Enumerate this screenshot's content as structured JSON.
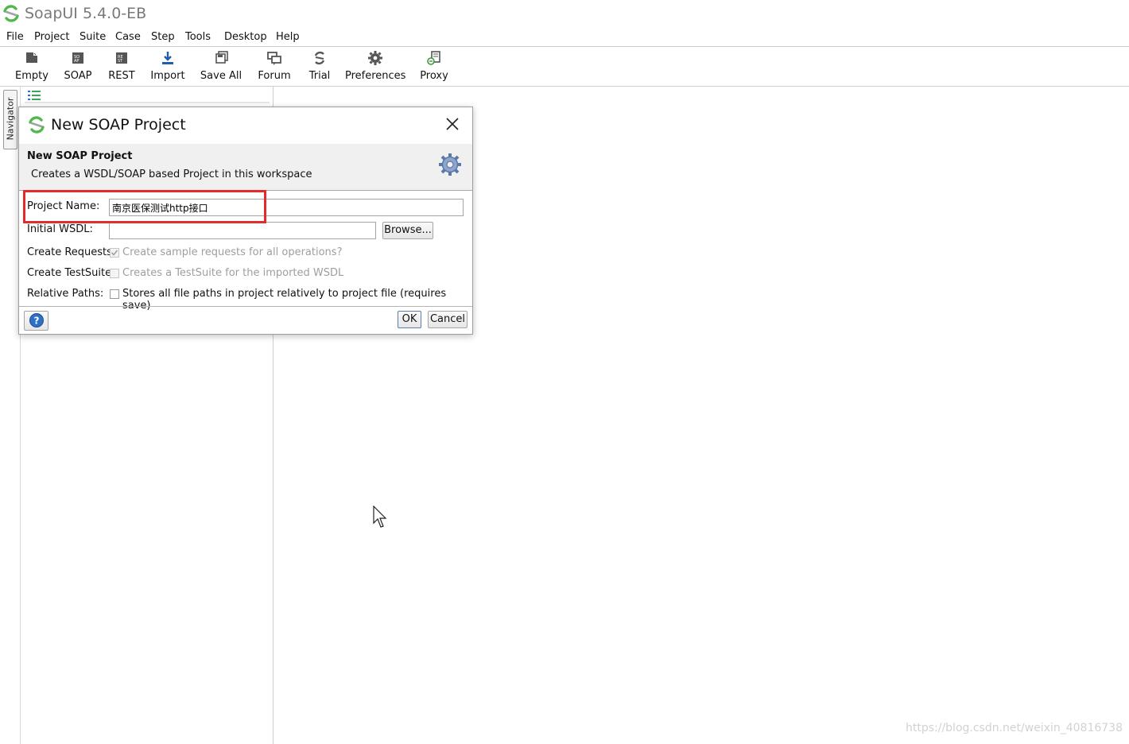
{
  "app": {
    "title": "SoapUI 5.4.0-EB"
  },
  "menu": [
    "File",
    "Project",
    "Suite",
    "Case",
    "Step",
    "Tools",
    "Desktop",
    "Help"
  ],
  "toolbar": [
    {
      "label": "Empty",
      "icon": "empty-project-icon"
    },
    {
      "label": "SOAP",
      "icon": "soap-project-icon"
    },
    {
      "label": "REST",
      "icon": "rest-project-icon"
    },
    {
      "label": "Import",
      "icon": "import-icon"
    },
    {
      "label": "Save All",
      "icon": "save-all-icon"
    },
    {
      "label": "Forum",
      "icon": "forum-icon"
    },
    {
      "label": "Trial",
      "icon": "trial-icon"
    },
    {
      "label": "Preferences",
      "icon": "gear-icon"
    },
    {
      "label": "Proxy",
      "icon": "proxy-icon"
    }
  ],
  "navigator": {
    "tab_label": "Navigator"
  },
  "dialog": {
    "title": "New SOAP Project",
    "header_title": "New SOAP Project",
    "header_desc": "Creates a WSDL/SOAP based Project in this workspace",
    "fields": {
      "project_name_label": "Project Name:",
      "project_name_value": "南京医保测试http接口",
      "initial_wsdl_label": "Initial WSDL:",
      "initial_wsdl_value": "",
      "browse_label": "Browse...",
      "create_requests_label": "Create Requests:",
      "create_requests_text": "Create sample requests for all operations?",
      "create_requests_checked": true,
      "create_testsuite_label": "Create TestSuite:",
      "create_testsuite_text": "Creates a TestSuite for the imported WSDL",
      "create_testsuite_checked": false,
      "relative_paths_label": "Relative Paths:",
      "relative_paths_text": "Stores all file paths in project relatively to project file (requires save)",
      "relative_paths_checked": false
    },
    "buttons": {
      "ok": "OK",
      "cancel": "Cancel"
    }
  },
  "colors": {
    "highlight": "#e32b2b",
    "logo_green": "#4fb84a"
  },
  "watermark": "https://blog.csdn.net/weixin_40816738"
}
